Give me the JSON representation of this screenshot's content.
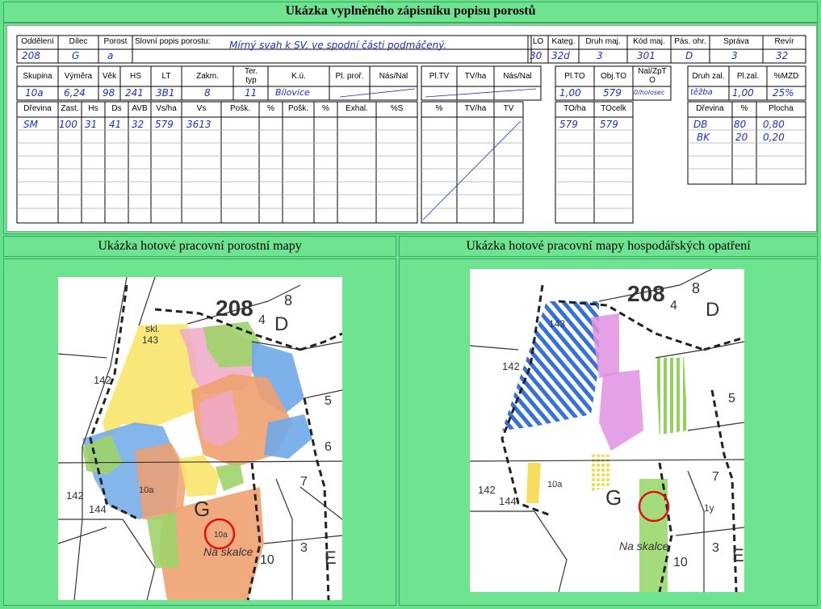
{
  "top_title": "Ukázka vyplněného zápisníku popisu porostů",
  "left_title": "Ukázka hotové pracovní porostní mapy",
  "right_title": "Ukázka hotové pracovní  mapy hospodářských opatření",
  "form": {
    "row1_headers": [
      "Oddělení",
      "Dílec",
      "Porost",
      "Slovní popis porostu:",
      "LO",
      "Kateg.",
      "Druh maj.",
      "Kód maj.",
      "Pás. ohr.",
      "Správa",
      "Revír"
    ],
    "row1_values": [
      "208",
      "G",
      "a",
      "Mírný svah k SV, ve spodní části podmáčený.",
      "30",
      "32d",
      "3",
      "301",
      "D",
      "3",
      "32"
    ],
    "row2_headers": [
      "Skupina",
      "Výměra",
      "Věk",
      "HS",
      "LT",
      "Zakm.",
      "Ter. typ",
      "K.ú.",
      "Pl. proř.",
      "Nás/Nal"
    ],
    "row2_values": [
      "10a",
      "6,24",
      "98",
      "241",
      "3B1",
      "8",
      "11",
      "Bílovice"
    ],
    "row2_mid_headers": [
      "Pl.TV",
      "TV/ha",
      "Nás/Nal"
    ],
    "row2_right_headers": [
      "Pl.TO",
      "Obj.TO",
      "Nal/ZpT O"
    ],
    "row2_right_values": [
      "1,00",
      "579",
      "0/holosec"
    ],
    "zal_headers": [
      "Druh zal.",
      "Pl.zal.",
      "%MZD"
    ],
    "zal_values": [
      "těžba",
      "1,00",
      "25%"
    ],
    "row3_headers": [
      "Dřevina",
      "Zast.",
      "Hs",
      "Ds",
      "AVB",
      "Vs/ha",
      "Vs",
      "Pošk.",
      "%",
      "Pošk.",
      "%",
      "Exhal.",
      "%S"
    ],
    "row3_values": [
      "SM",
      "100",
      "31",
      "41",
      "32",
      "579",
      "3613"
    ],
    "row3_mid_headers": [
      "%",
      "TV/ha",
      "TV"
    ],
    "to_headers": [
      "TO/ha",
      "TOcelk"
    ],
    "to_values": [
      "579",
      "579"
    ],
    "drevina_headers": [
      "Dřevina",
      "%",
      "Plocha"
    ],
    "drevina_rows": [
      [
        "DB",
        "80",
        "0,80"
      ],
      [
        "BK",
        "20",
        "0,20"
      ]
    ]
  },
  "map_left": {
    "labels": [
      "208",
      "D",
      "8",
      "4",
      "skl.",
      "143",
      "142",
      "142",
      "144",
      "G",
      "10a",
      "Na skalce",
      "10",
      "5",
      "6",
      "7",
      "3",
      "E",
      "10a"
    ]
  },
  "map_right": {
    "labels": [
      "208",
      "D",
      "8",
      "4",
      "143",
      "142",
      "142",
      "144",
      "G",
      "10a",
      "Na skalce",
      "10",
      "5",
      "7",
      "3",
      "E",
      "1y"
    ]
  }
}
